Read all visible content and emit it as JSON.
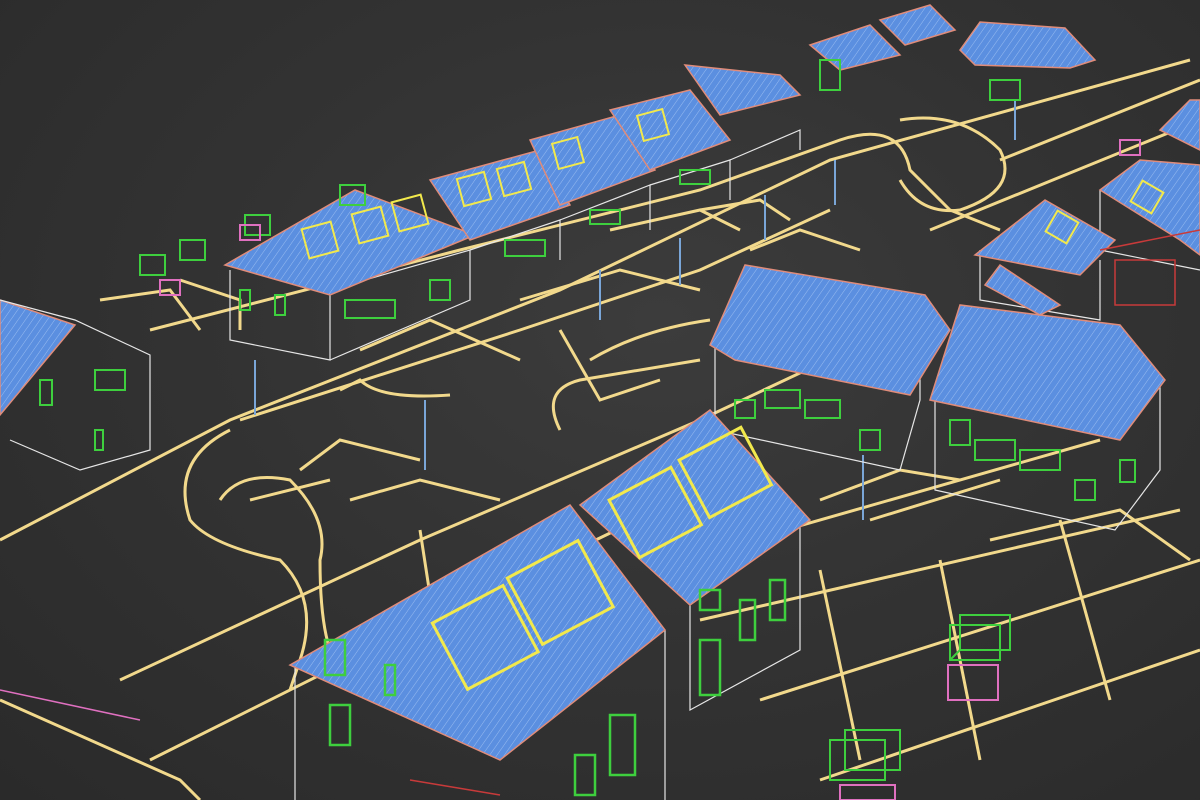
{
  "viewport": {
    "mode": "wireframe",
    "background": "#333333",
    "colors": {
      "site_lines": "#f2d98c",
      "roof_fill": "#5b8fe0",
      "roof_edge": "#e08c7a",
      "walls": "#e6e6e6",
      "windows": "#3ecf3e",
      "solar_panels": "#f2e94c",
      "pink_accents": "#e070c0",
      "red_accents": "#c83a3a",
      "poles": "#7aa6d8"
    }
  },
  "scene": {
    "houses_front_row": 6,
    "houses_back_row": 8,
    "houses_right_cluster": 6,
    "bin_stores": 6
  }
}
